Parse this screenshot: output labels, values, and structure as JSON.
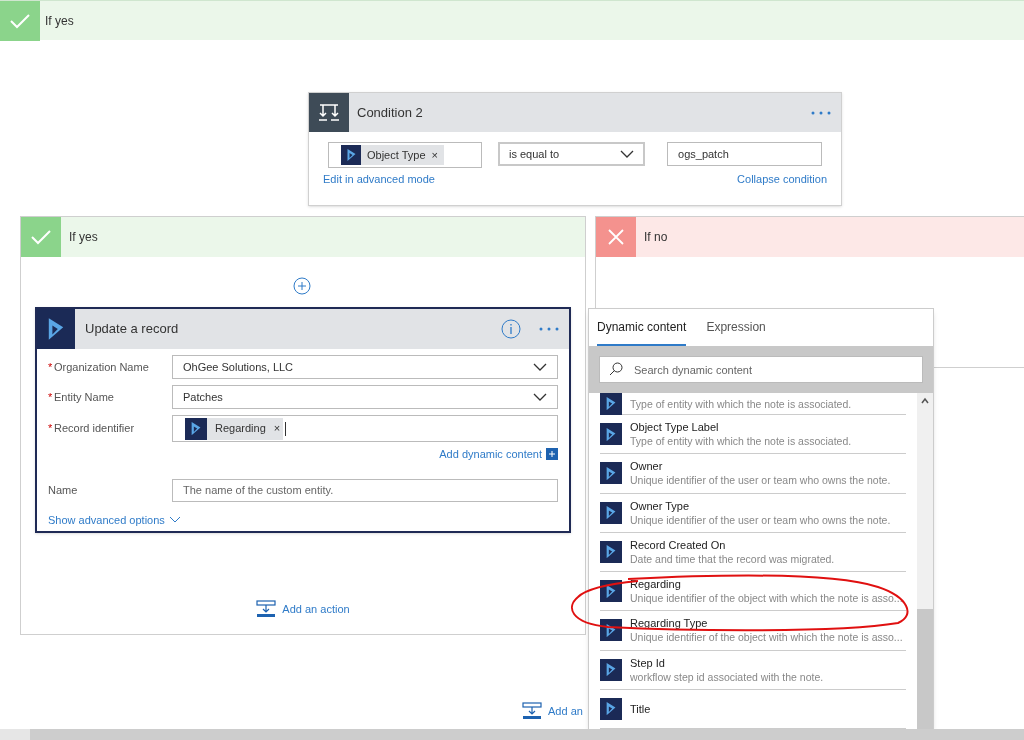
{
  "top_branch": {
    "label": "If yes"
  },
  "condition": {
    "title": "Condition 2",
    "left_token": "Object Type",
    "remove": "×",
    "operator": "is equal to",
    "value": "ogs_patch",
    "edit_link": "Edit in advanced mode",
    "collapse_link": "Collapse condition"
  },
  "yes_branch": {
    "label": "If yes",
    "add_action": "Add an action"
  },
  "no_branch": {
    "label": "If no"
  },
  "action": {
    "title": "Update a record",
    "fields": [
      {
        "label": "Organization Name",
        "required": true,
        "kind": "dropdown",
        "value": "OhGee Solutions, LLC"
      },
      {
        "label": "Entity Name",
        "required": true,
        "kind": "dropdown",
        "value": "Patches"
      },
      {
        "label": "Record identifier",
        "required": true,
        "kind": "token",
        "value": "Regarding"
      },
      {
        "label": "Name",
        "required": false,
        "kind": "text",
        "placeholder": "The name of the custom entity."
      }
    ],
    "required_mark": "*",
    "remove": "×",
    "add_dynamic": "Add dynamic content",
    "advanced": "Show advanced options"
  },
  "popup": {
    "tabs": [
      {
        "label": "Dynamic content",
        "selected": true
      },
      {
        "label": "Expression",
        "selected": false
      }
    ],
    "search": {
      "placeholder": "Search dynamic content"
    },
    "items": [
      {
        "description": "Type of entity with which the note is associated."
      },
      {
        "title": "Object Type Label",
        "description": "Type of entity with which the note is associated."
      },
      {
        "title": "Owner",
        "description": "Unique identifier of the user or team who owns the note."
      },
      {
        "title": "Owner Type",
        "description": "Unique identifier of the user or team who owns the note."
      },
      {
        "title": "Record Created On",
        "description": "Date and time that the record was migrated."
      },
      {
        "title": "Regarding",
        "description": "Unique identifier of the object with which the note is asso..."
      },
      {
        "title": "Regarding Type",
        "description": "Unique identifier of the object with which the note is asso..."
      },
      {
        "title": "Step Id",
        "description": "workflow step id associated with the note."
      },
      {
        "title": "Title"
      }
    ]
  },
  "bottom_add": "Add an"
}
